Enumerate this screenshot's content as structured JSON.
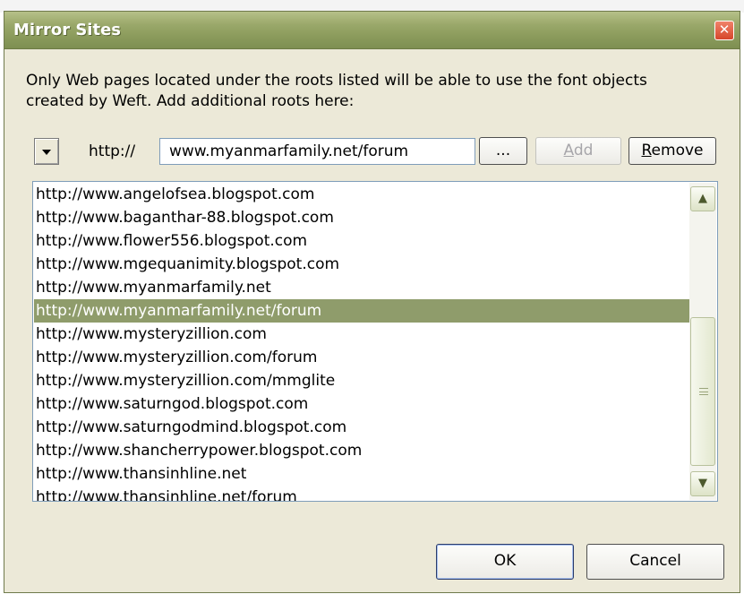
{
  "window": {
    "title": "Mirror Sites",
    "close_icon": "close-icon"
  },
  "description": "Only Web pages located under the roots listed will be able to use the font objects created by Weft. Add additional roots here:",
  "toolbar": {
    "protocol_prefix": "http://",
    "url_value": "www.myanmarfamily.net/forum",
    "browse_label": "...",
    "add_label": "Add",
    "add_accel": "A",
    "add_rest": "dd",
    "remove_label": "Remove",
    "remove_accel": "R",
    "remove_rest": "emove"
  },
  "list": {
    "items": [
      "http://www.angelofsea.blogspot.com",
      "http://www.baganthar-88.blogspot.com",
      "http://www.flower556.blogspot.com",
      "http://www.mgequanimity.blogspot.com",
      "http://www.myanmarfamily.net",
      "http://www.myanmarfamily.net/forum",
      "http://www.mysteryzillion.com",
      "http://www.mysteryzillion.com/forum",
      "http://www.mysteryzillion.com/mmglite",
      "http://www.saturngod.blogspot.com",
      "http://www.saturngodmind.blogspot.com",
      "http://www.shancherrypower.blogspot.com",
      "http://www.thansinhline.net",
      "http://www.thansinhline.net/forum"
    ],
    "selected_index": 5
  },
  "footer": {
    "ok_label": "OK",
    "cancel_label": "Cancel"
  },
  "colors": {
    "titlebar": "#8a9a5b",
    "selection": "#8f9c6b",
    "dialog_bg": "#ece9d8"
  }
}
